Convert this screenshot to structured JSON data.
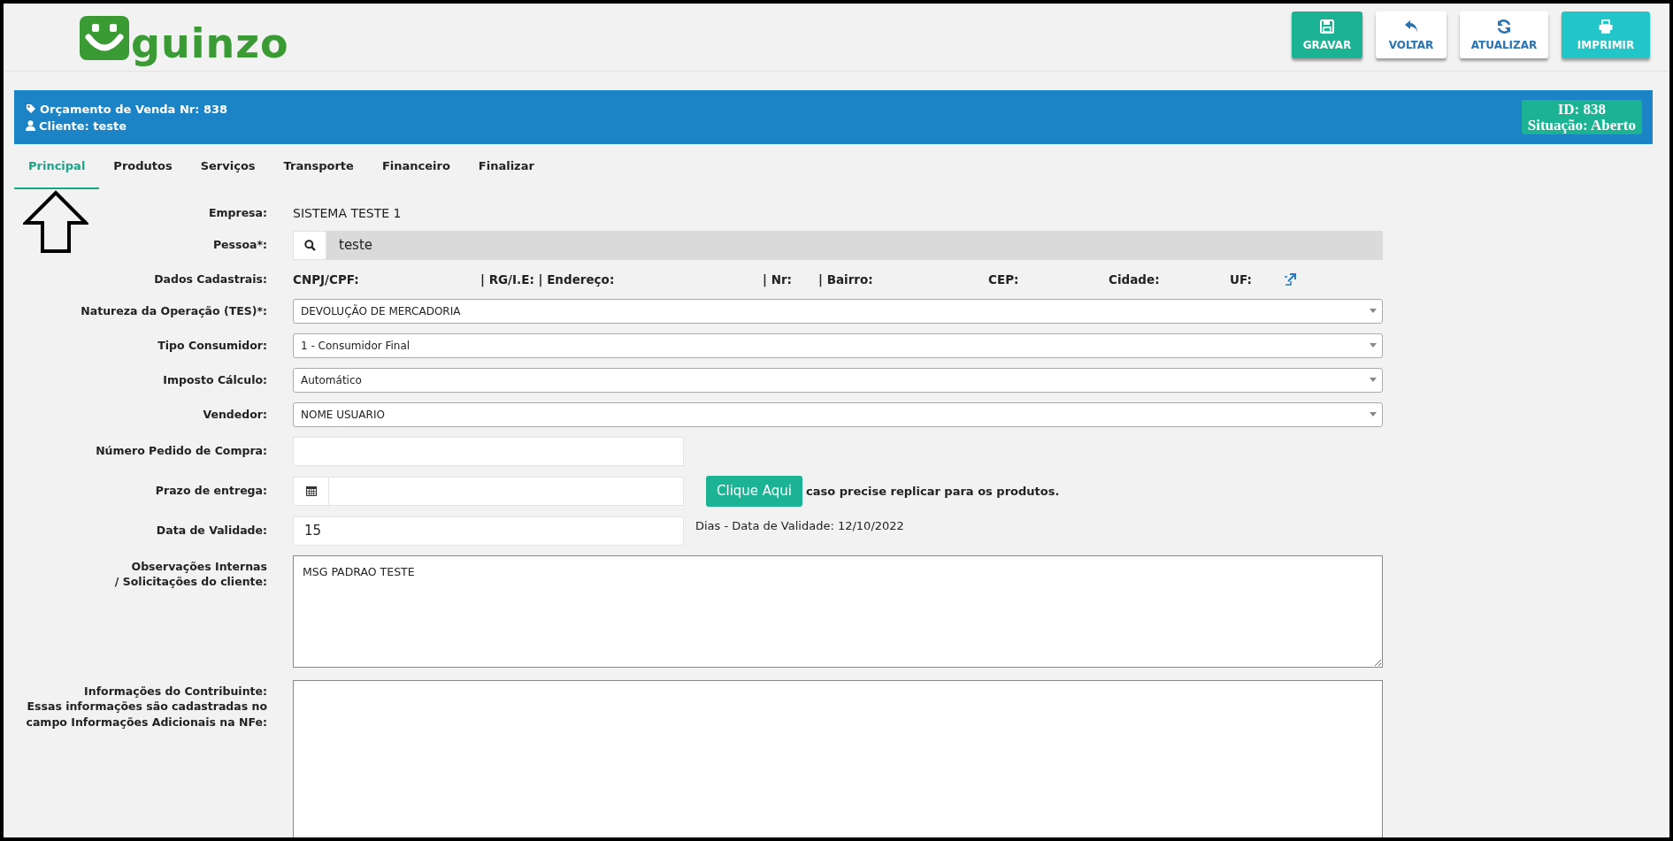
{
  "logo": {
    "text": "guinzo"
  },
  "toolbar": [
    {
      "label": "GRAVAR",
      "kind": "save"
    },
    {
      "label": "VOLTAR",
      "kind": "back"
    },
    {
      "label": "ATUALIZAR",
      "kind": "refresh"
    },
    {
      "label": "IMPRIMIR",
      "kind": "print"
    }
  ],
  "header": {
    "title": "Orçamento de Venda Nr: 838",
    "client": "Cliente: teste",
    "id": "ID: 838",
    "status": "Situação: Aberto"
  },
  "tabs": [
    {
      "label": "Principal",
      "selected": true
    },
    {
      "label": "Produtos",
      "selected": false
    },
    {
      "label": "Serviços",
      "selected": false
    },
    {
      "label": "Transporte",
      "selected": false
    },
    {
      "label": "Financeiro",
      "selected": false
    },
    {
      "label": "Finalizar",
      "selected": false
    }
  ],
  "form": {
    "rows": [
      {
        "kind": "text",
        "label": "Empresa:",
        "value": "SISTEMA TESTE 1"
      },
      {
        "kind": "search",
        "label": "Pessoa*:",
        "value": "teste"
      },
      {
        "kind": "details",
        "label": "Dados Cadastrais:",
        "fields": [
          "CNPJ/CPF:",
          "| RG/I.E: | Endereço:",
          "| Nr:",
          "| Bairro:",
          "CEP:",
          "Cidade:",
          "UF:"
        ]
      },
      {
        "kind": "select",
        "label": "Natureza da Operação (TES)*:",
        "value": "DEVOLUÇÃO DE MERCADORIA"
      },
      {
        "kind": "select",
        "label": "Tipo Consumidor:",
        "value": "1 - Consumidor Final"
      },
      {
        "kind": "select",
        "label": "Imposto Cálculo:",
        "value": "Automático"
      },
      {
        "kind": "select",
        "label": "Vendedor:",
        "value": "NOME USUARIO"
      },
      {
        "kind": "input",
        "label": "Número Pedido de Compra:"
      },
      {
        "kind": "date",
        "label": "Prazo de entrega:",
        "button": "Clique Aqui",
        "note": "caso precise replicar para os produtos."
      },
      {
        "kind": "input",
        "label": "Data de Validade:",
        "value": "15",
        "note": "Dias - Data de Validade: 12/10/2022"
      },
      {
        "kind": "textarea",
        "label": "Observações Internas\n/ Solicitações do cliente:",
        "value": "MSG PADRAO TESTE"
      },
      {
        "kind": "textarea",
        "label": "Informações do Contribuinte:\nEssas informações são cadastradas no\ncampo Informações Adicionais na NFe:"
      }
    ]
  }
}
